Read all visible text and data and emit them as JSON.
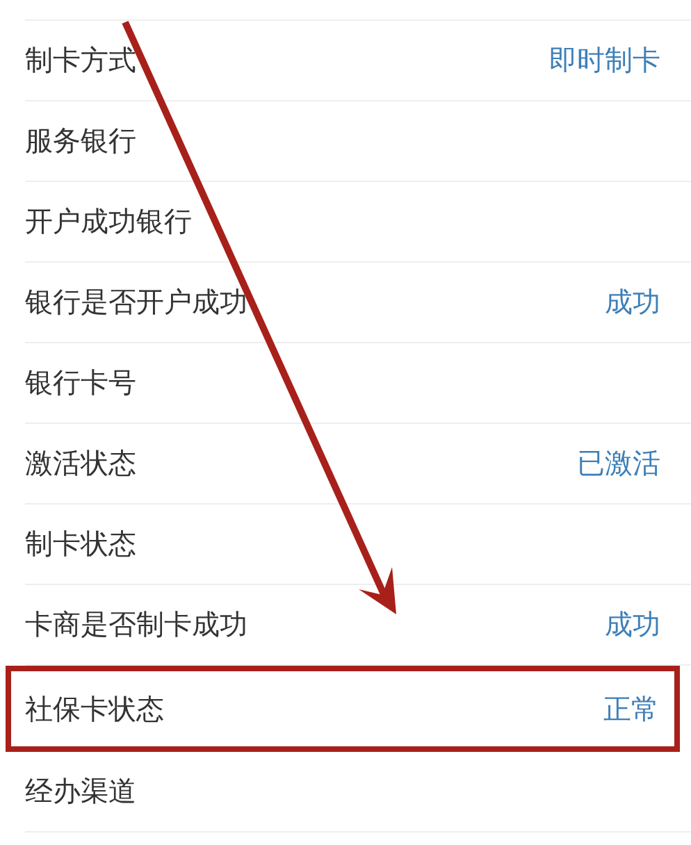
{
  "rows": [
    {
      "label": "制卡方式",
      "value": "即时制卡",
      "highlighted": false
    },
    {
      "label": "服务银行",
      "highlighted": false
    },
    {
      "label": "开户成功银行",
      "highlighted": false
    },
    {
      "label": "银行是否开户成功",
      "value": "成功",
      "highlighted": false
    },
    {
      "label": "银行卡号",
      "highlighted": false
    },
    {
      "label": "激活状态",
      "value": "已激活",
      "highlighted": false
    },
    {
      "label": "制卡状态",
      "highlighted": false
    },
    {
      "label": "卡商是否制卡成功",
      "value": "成功",
      "highlighted": false
    },
    {
      "label": "社保卡状态",
      "value": "正常",
      "highlighted": true
    },
    {
      "label": "经办渠道",
      "highlighted": false
    }
  ]
}
